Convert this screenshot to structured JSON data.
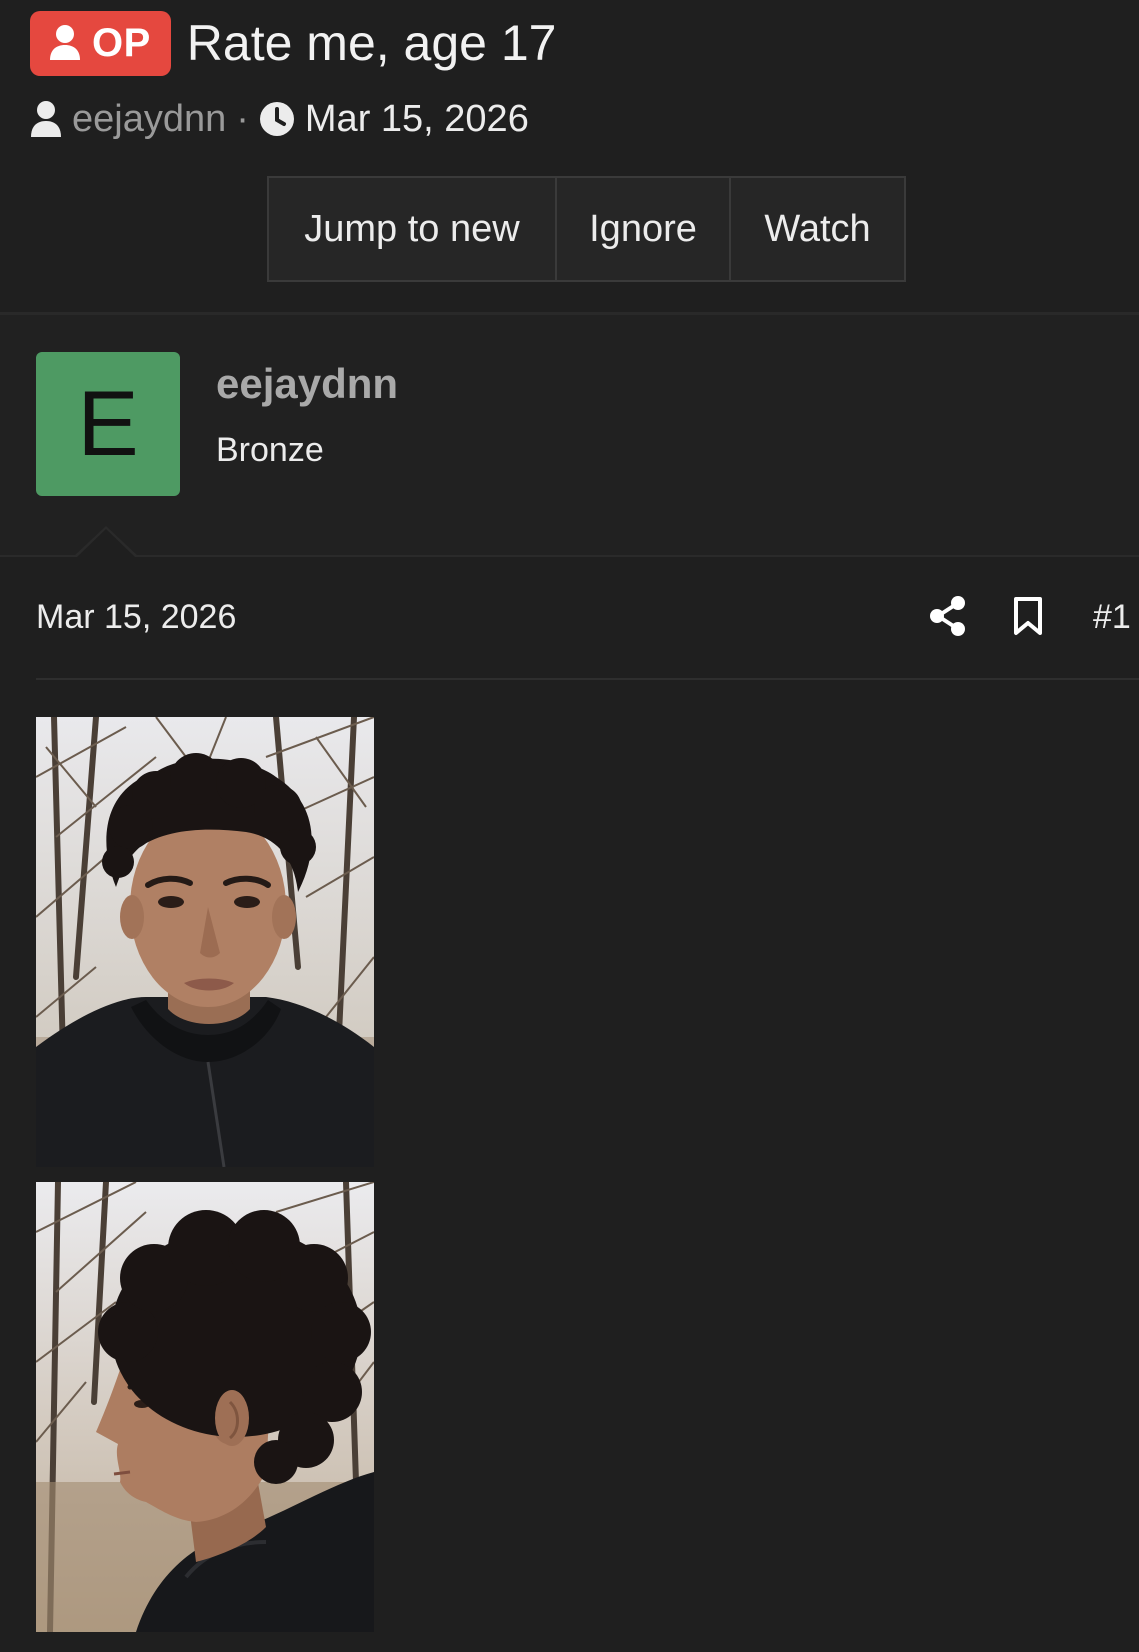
{
  "thread": {
    "op_badge": "OP",
    "title": "Rate me, age 17",
    "author": "eejaydnn",
    "separator": "·",
    "date": "Mar 15, 2026"
  },
  "actions": {
    "jump_to_new": "Jump to new",
    "ignore": "Ignore",
    "watch": "Watch"
  },
  "post": {
    "avatar_letter": "E",
    "avatar_color": "#4e9a63",
    "author_name": "eejaydnn",
    "author_rank": "Bronze",
    "date": "Mar 15, 2026",
    "number": "#1",
    "attachments": [
      {
        "icon": "photo-front-face"
      },
      {
        "icon": "photo-side-profile"
      }
    ]
  },
  "colors": {
    "background": "#1f1f1f",
    "op_badge": "#e5483f",
    "muted_text": "#9a9a9a"
  }
}
